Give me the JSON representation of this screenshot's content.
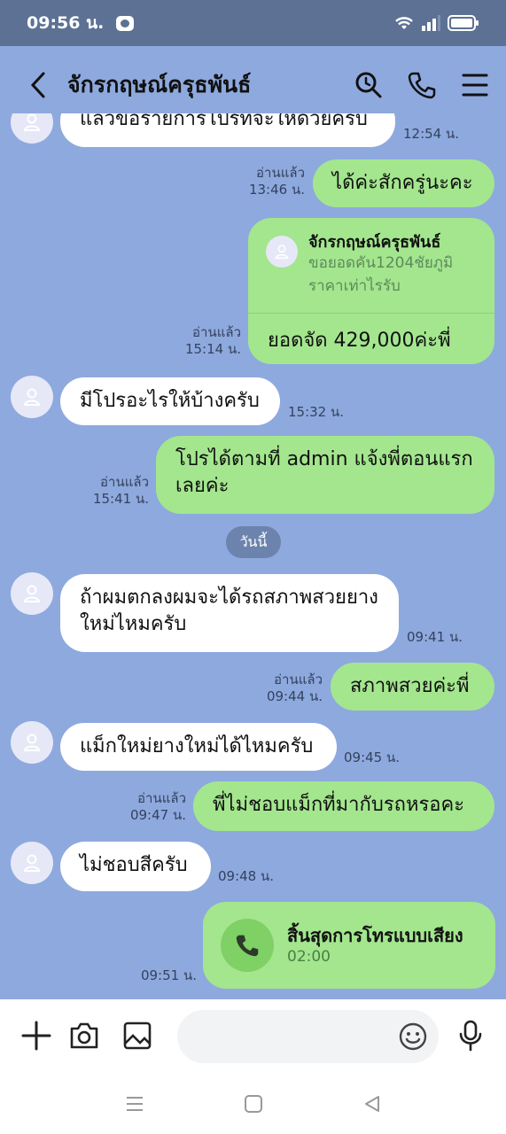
{
  "status": {
    "time": "09:56 น."
  },
  "header": {
    "title": "จักรกฤษณ์ครุธพันธ์"
  },
  "date_divider": "วันนี้",
  "messages": [
    {
      "id": "m0",
      "text": "แล้วขอรายการโปรที่จะให้ด้วยครับ",
      "time": "12:54 น."
    },
    {
      "id": "m1",
      "text": "ได้ค่ะสักครู่นะคะ",
      "read": "อ่านแล้ว",
      "time": "13:46 น."
    },
    {
      "id": "m2",
      "read": "อ่านแล้ว",
      "time": "15:14 น."
    },
    {
      "id": "m3",
      "text": "มีโปรอะไรให้บ้างครับ",
      "time": "15:32 น."
    },
    {
      "id": "m4",
      "text": "โปรได้ตามที่ admin แจ้งพี่ตอนแรกเลยค่ะ",
      "read": "อ่านแล้ว",
      "time": "15:41 น."
    },
    {
      "id": "m5",
      "text": "ถ้าผมตกลงผมจะได้รถสภาพสวยยางใหม่ไหมครับ",
      "time": "09:41 น."
    },
    {
      "id": "m6",
      "text": "สภาพสวยค่ะพี่",
      "read": "อ่านแล้ว",
      "time": "09:44 น."
    },
    {
      "id": "m7",
      "text": "แม็กใหม่ยางใหม่ได้ไหมครับ",
      "time": "09:45 น."
    },
    {
      "id": "m8",
      "text": "พี่ไม่ชอบแม็กที่มากับรถหรอคะ",
      "read": "อ่านแล้ว",
      "time": "09:47 น."
    },
    {
      "id": "m9",
      "text": "ไม่ชอบสีครับ",
      "time": "09:48 น."
    },
    {
      "id": "m10",
      "time": "09:51 น."
    }
  ],
  "contact_card": {
    "name": "จักรกฤษณ์ครุธพันธ์",
    "subtitle": "ขอยอดคัน1204ชัยภูมิ ราคาเท่าไรรับ",
    "text": "ยอดจัด 429,000ค่ะพี่"
  },
  "call_card": {
    "title": "สิ้นสุดการโทรแบบเสียง",
    "duration": "02:00"
  },
  "input": {
    "placeholder": ""
  },
  "colors": {
    "background": "#8ea9de",
    "outgoing": "#a3e68e",
    "incoming": "#ffffff",
    "status_bar": "#5c7194"
  }
}
